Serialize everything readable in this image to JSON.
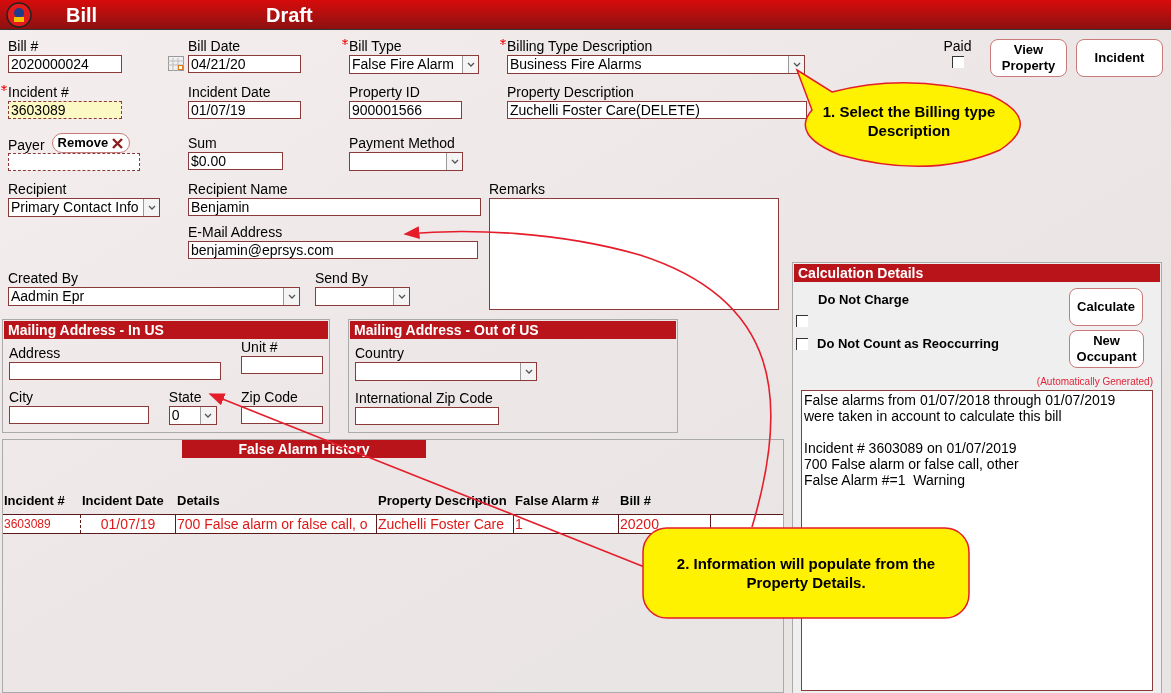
{
  "header": {
    "title": "Bill",
    "status": "Draft"
  },
  "form": {
    "bill_number": {
      "label": "Bill #",
      "value": "2020000024"
    },
    "bill_date": {
      "label": "Bill Date",
      "value": "04/21/20"
    },
    "bill_type": {
      "label": "Bill Type",
      "value": "False Fire Alarm",
      "required": true
    },
    "billing_type_description": {
      "label": "Billing Type Description",
      "value": "Business Fire Alarms",
      "required": true
    },
    "paid": {
      "label": "Paid",
      "checked": false
    },
    "incident_number": {
      "label": "Incident #",
      "value": "3603089",
      "required": true
    },
    "incident_date": {
      "label": "Incident Date",
      "value": "01/07/19"
    },
    "property_id": {
      "label": "Property ID",
      "value": "900001566"
    },
    "property_description": {
      "label": "Property Description",
      "value": "Zuchelli Foster Care(DELETE)"
    },
    "payer": {
      "label": "Payer",
      "remove_label": "Remove"
    },
    "sum": {
      "label": "Sum",
      "value": "$0.00"
    },
    "payment_method": {
      "label": "Payment Method"
    },
    "recipient": {
      "label": "Recipient",
      "value": "Primary Contact Info"
    },
    "recipient_name": {
      "label": "Recipient Name",
      "value": "Benjamin"
    },
    "remarks": {
      "label": "Remarks"
    },
    "email": {
      "label": "E-Mail Address",
      "value": "benjamin@eprsys.com"
    },
    "created_by": {
      "label": "Created By",
      "value": "Aadmin Epr"
    },
    "send_by": {
      "label": "Send By"
    }
  },
  "buttons": [
    "View Property",
    "Incident"
  ],
  "mailing_us": {
    "title": "Mailing Address - In US",
    "address": {
      "label": "Address"
    },
    "unit": {
      "label": "Unit #"
    },
    "city": {
      "label": "City"
    },
    "state": {
      "label": "State",
      "value": "0"
    },
    "zip": {
      "label": "Zip Code"
    }
  },
  "mailing_intl": {
    "title": "Mailing Address - Out of US",
    "country": {
      "label": "Country"
    },
    "zip": {
      "label": "International Zip Code"
    }
  },
  "history": {
    "title": "False Alarm History",
    "columns": [
      "Incident #",
      "Incident Date",
      "Details",
      "Property Description",
      "False Alarm #",
      "Bill #"
    ],
    "rows": [
      {
        "cells": [
          "3603089",
          "01/07/19",
          "700 False alarm or false call, o",
          "Zuchelli Foster Care",
          "1",
          "20200"
        ]
      }
    ]
  },
  "calculation": {
    "title": "Calculation Details",
    "do_not_charge": {
      "label": "Do Not Charge",
      "checked": false
    },
    "do_not_count": {
      "label": "Do Not Count as Reoccurring",
      "checked": false
    },
    "buttons": [
      "Calculate",
      "New Occupant"
    ],
    "note": "(Automatically Generated)",
    "paragraphs": [
      [
        "False alarms from 01/07/2018 through 01/07/2019",
        "were taken in account to calculate this bill"
      ],
      [
        "Incident # 3603089 on 01/07/2019",
        "700 False alarm or false call, other",
        "False Alarm #=1  Warning"
      ]
    ]
  },
  "callouts": [
    "1. Select the Billing type Description",
    "2. Information will populate from the Property Details."
  ]
}
